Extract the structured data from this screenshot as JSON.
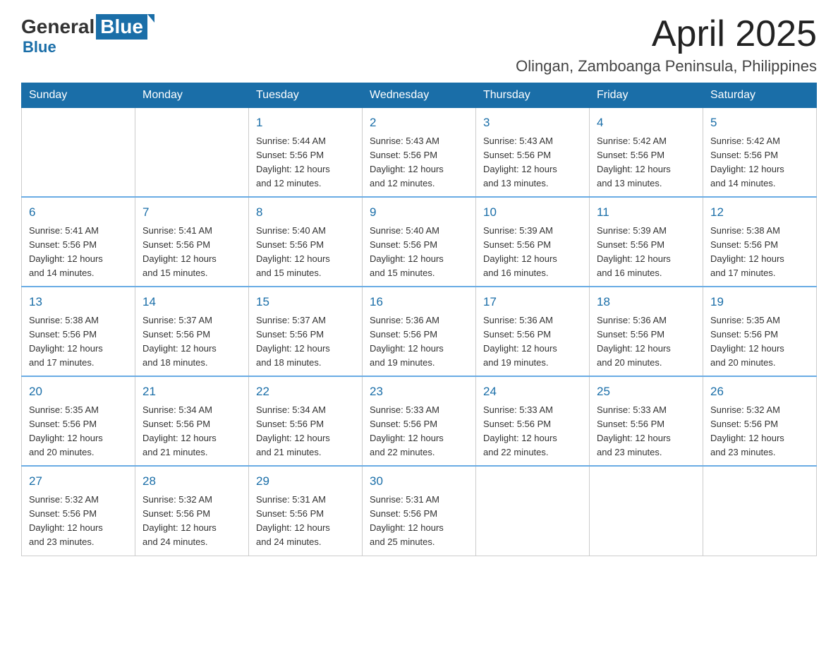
{
  "header": {
    "logo": {
      "general": "General",
      "blue": "Blue"
    },
    "title": "April 2025",
    "location": "Olingan, Zamboanga Peninsula, Philippines"
  },
  "calendar": {
    "weekdays": [
      "Sunday",
      "Monday",
      "Tuesday",
      "Wednesday",
      "Thursday",
      "Friday",
      "Saturday"
    ],
    "weeks": [
      [
        {
          "day": "",
          "info": ""
        },
        {
          "day": "",
          "info": ""
        },
        {
          "day": "1",
          "info": "Sunrise: 5:44 AM\nSunset: 5:56 PM\nDaylight: 12 hours\nand 12 minutes."
        },
        {
          "day": "2",
          "info": "Sunrise: 5:43 AM\nSunset: 5:56 PM\nDaylight: 12 hours\nand 12 minutes."
        },
        {
          "day": "3",
          "info": "Sunrise: 5:43 AM\nSunset: 5:56 PM\nDaylight: 12 hours\nand 13 minutes."
        },
        {
          "day": "4",
          "info": "Sunrise: 5:42 AM\nSunset: 5:56 PM\nDaylight: 12 hours\nand 13 minutes."
        },
        {
          "day": "5",
          "info": "Sunrise: 5:42 AM\nSunset: 5:56 PM\nDaylight: 12 hours\nand 14 minutes."
        }
      ],
      [
        {
          "day": "6",
          "info": "Sunrise: 5:41 AM\nSunset: 5:56 PM\nDaylight: 12 hours\nand 14 minutes."
        },
        {
          "day": "7",
          "info": "Sunrise: 5:41 AM\nSunset: 5:56 PM\nDaylight: 12 hours\nand 15 minutes."
        },
        {
          "day": "8",
          "info": "Sunrise: 5:40 AM\nSunset: 5:56 PM\nDaylight: 12 hours\nand 15 minutes."
        },
        {
          "day": "9",
          "info": "Sunrise: 5:40 AM\nSunset: 5:56 PM\nDaylight: 12 hours\nand 15 minutes."
        },
        {
          "day": "10",
          "info": "Sunrise: 5:39 AM\nSunset: 5:56 PM\nDaylight: 12 hours\nand 16 minutes."
        },
        {
          "day": "11",
          "info": "Sunrise: 5:39 AM\nSunset: 5:56 PM\nDaylight: 12 hours\nand 16 minutes."
        },
        {
          "day": "12",
          "info": "Sunrise: 5:38 AM\nSunset: 5:56 PM\nDaylight: 12 hours\nand 17 minutes."
        }
      ],
      [
        {
          "day": "13",
          "info": "Sunrise: 5:38 AM\nSunset: 5:56 PM\nDaylight: 12 hours\nand 17 minutes."
        },
        {
          "day": "14",
          "info": "Sunrise: 5:37 AM\nSunset: 5:56 PM\nDaylight: 12 hours\nand 18 minutes."
        },
        {
          "day": "15",
          "info": "Sunrise: 5:37 AM\nSunset: 5:56 PM\nDaylight: 12 hours\nand 18 minutes."
        },
        {
          "day": "16",
          "info": "Sunrise: 5:36 AM\nSunset: 5:56 PM\nDaylight: 12 hours\nand 19 minutes."
        },
        {
          "day": "17",
          "info": "Sunrise: 5:36 AM\nSunset: 5:56 PM\nDaylight: 12 hours\nand 19 minutes."
        },
        {
          "day": "18",
          "info": "Sunrise: 5:36 AM\nSunset: 5:56 PM\nDaylight: 12 hours\nand 20 minutes."
        },
        {
          "day": "19",
          "info": "Sunrise: 5:35 AM\nSunset: 5:56 PM\nDaylight: 12 hours\nand 20 minutes."
        }
      ],
      [
        {
          "day": "20",
          "info": "Sunrise: 5:35 AM\nSunset: 5:56 PM\nDaylight: 12 hours\nand 20 minutes."
        },
        {
          "day": "21",
          "info": "Sunrise: 5:34 AM\nSunset: 5:56 PM\nDaylight: 12 hours\nand 21 minutes."
        },
        {
          "day": "22",
          "info": "Sunrise: 5:34 AM\nSunset: 5:56 PM\nDaylight: 12 hours\nand 21 minutes."
        },
        {
          "day": "23",
          "info": "Sunrise: 5:33 AM\nSunset: 5:56 PM\nDaylight: 12 hours\nand 22 minutes."
        },
        {
          "day": "24",
          "info": "Sunrise: 5:33 AM\nSunset: 5:56 PM\nDaylight: 12 hours\nand 22 minutes."
        },
        {
          "day": "25",
          "info": "Sunrise: 5:33 AM\nSunset: 5:56 PM\nDaylight: 12 hours\nand 23 minutes."
        },
        {
          "day": "26",
          "info": "Sunrise: 5:32 AM\nSunset: 5:56 PM\nDaylight: 12 hours\nand 23 minutes."
        }
      ],
      [
        {
          "day": "27",
          "info": "Sunrise: 5:32 AM\nSunset: 5:56 PM\nDaylight: 12 hours\nand 23 minutes."
        },
        {
          "day": "28",
          "info": "Sunrise: 5:32 AM\nSunset: 5:56 PM\nDaylight: 12 hours\nand 24 minutes."
        },
        {
          "day": "29",
          "info": "Sunrise: 5:31 AM\nSunset: 5:56 PM\nDaylight: 12 hours\nand 24 minutes."
        },
        {
          "day": "30",
          "info": "Sunrise: 5:31 AM\nSunset: 5:56 PM\nDaylight: 12 hours\nand 25 minutes."
        },
        {
          "day": "",
          "info": ""
        },
        {
          "day": "",
          "info": ""
        },
        {
          "day": "",
          "info": ""
        }
      ]
    ]
  }
}
